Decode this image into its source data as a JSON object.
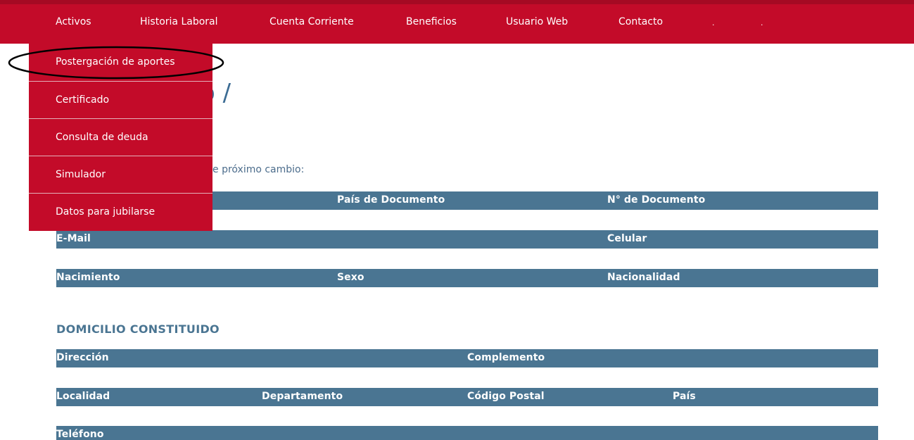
{
  "topnav": {
    "items": [
      "Activos",
      "Historia Laboral",
      "Cuenta Corriente",
      "Beneficios",
      "Usuario Web",
      "Contacto"
    ],
    "dots": [
      ".",
      "."
    ]
  },
  "dropdown": {
    "items": [
      "Postergación de aportes",
      "Certificado",
      "Consulta de deuda",
      "Simulador",
      "Datos para jubilarse"
    ]
  },
  "page": {
    "title": "o /",
    "intro": "e próximo cambio:"
  },
  "personal_rows": {
    "row1": [
      "País de Documento",
      "N° de Documento"
    ],
    "row2": [
      "E-Mail",
      "Celular"
    ],
    "row3": [
      "Nacimiento",
      "Sexo",
      "Nacionalidad"
    ]
  },
  "domicilio": {
    "heading": "DOMICILIO CONSTITUIDO",
    "row1": [
      "Dirección",
      "Complemento"
    ],
    "row2": [
      "Localidad",
      "Departamento",
      "Código Postal",
      "País"
    ],
    "row3": [
      "Teléfono"
    ]
  },
  "colors": {
    "nav_red": "#c30b29",
    "header_blue": "#4a7592",
    "title_blue": "#3c6c94"
  }
}
